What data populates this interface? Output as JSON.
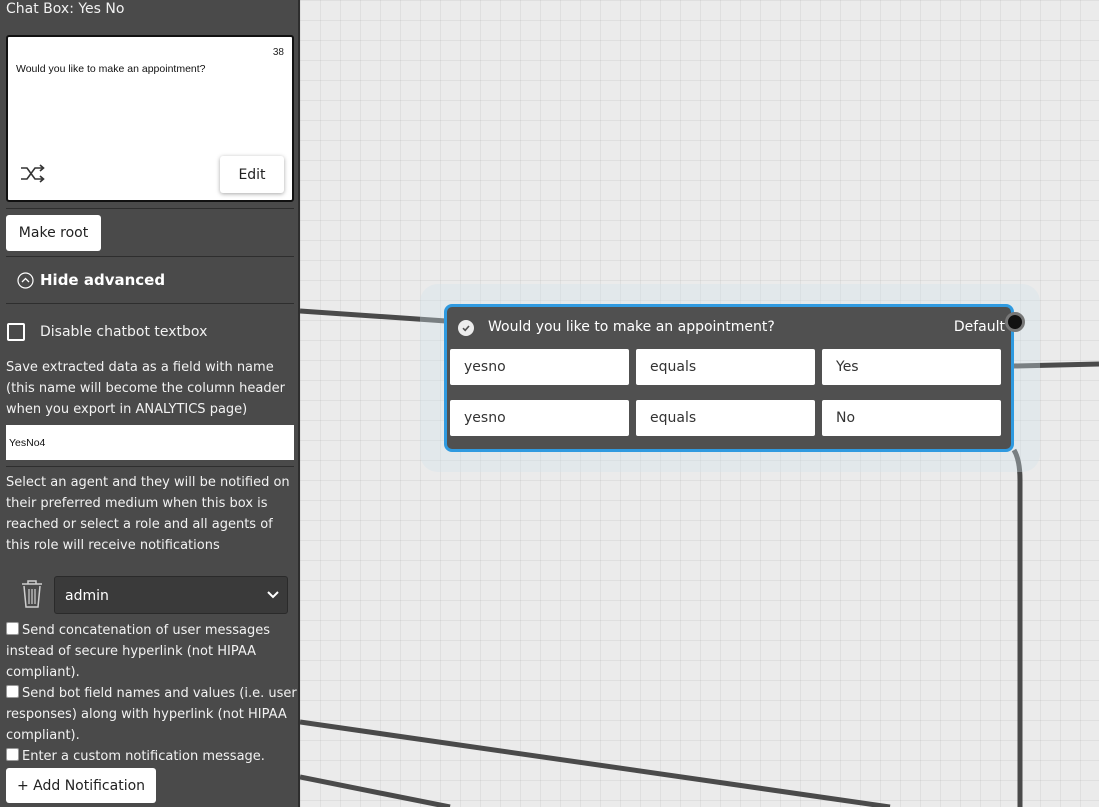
{
  "sidebar": {
    "title": "Chat Box: Yes No",
    "preview": {
      "count": "38",
      "message": "Would you like to make an appointment?",
      "edit_label": "Edit",
      "shuffle_icon": "shuffle-icon"
    },
    "make_root_label": "Make root",
    "advanced_toggle_label": "Hide advanced",
    "disable_textbox_label": "Disable chatbot textbox",
    "disable_textbox_checked": false,
    "save_field_help": "Save extracted data as a field with name (this name will become the column header when you export in ANALYTICS page)",
    "field_name_value": "YesNo4",
    "agent_help": "Select an agent and they will be notified on their preferred medium when this box is reached or select a role and all agents of this role will receive notifications",
    "agent_selected": "admin",
    "options": [
      {
        "label": "Send concatenation of user messages instead of secure hyperlink (not HIPAA compliant).",
        "checked": false
      },
      {
        "label": "Send bot field names and values (i.e. user responses) along with hyperlink (not HIPAA compliant).",
        "checked": false
      },
      {
        "label": "Enter a custom notification message.",
        "checked": false
      }
    ],
    "add_notification_label": "+ Add Notification"
  },
  "node": {
    "title": "Would you like to make an appointment?",
    "default_label": "Default",
    "border_color": "#2f9ae0",
    "conditions": [
      {
        "field": "yesno",
        "operator": "equals",
        "value": "Yes"
      },
      {
        "field": "yesno",
        "operator": "equals",
        "value": "No"
      }
    ]
  },
  "colors": {
    "sidebar_bg": "#4a4a4a",
    "node_bg": "#505050",
    "accent": "#2f9ae0",
    "canvas_bg": "#ebebeb"
  }
}
